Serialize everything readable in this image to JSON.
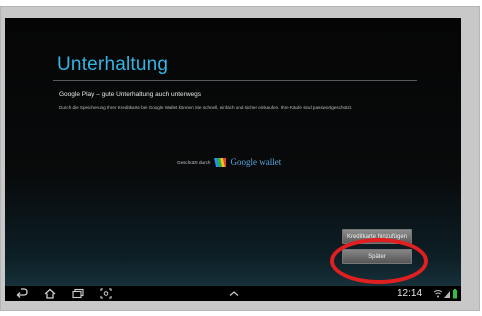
{
  "screen": {
    "title": "Unterhaltung",
    "subtitle": "Google Play – gute Unterhaltung auch unterwegs",
    "body": "Durch die Speicherung Ihrer Kreditkarte bei Google Wallet können Sie schnell, einfach und sicher einkaufen. Ihre Käufe sind passwortgeschützt.",
    "wallet": {
      "prefix": "Geschützt durch",
      "brand": "Google wallet"
    }
  },
  "buttons": {
    "add_card": "Kreditkarte hinzufügen",
    "later": "Später"
  },
  "status_bar": {
    "time": "12:14"
  },
  "colors": {
    "accent": "#33b5e5",
    "highlight": "#e02020"
  }
}
